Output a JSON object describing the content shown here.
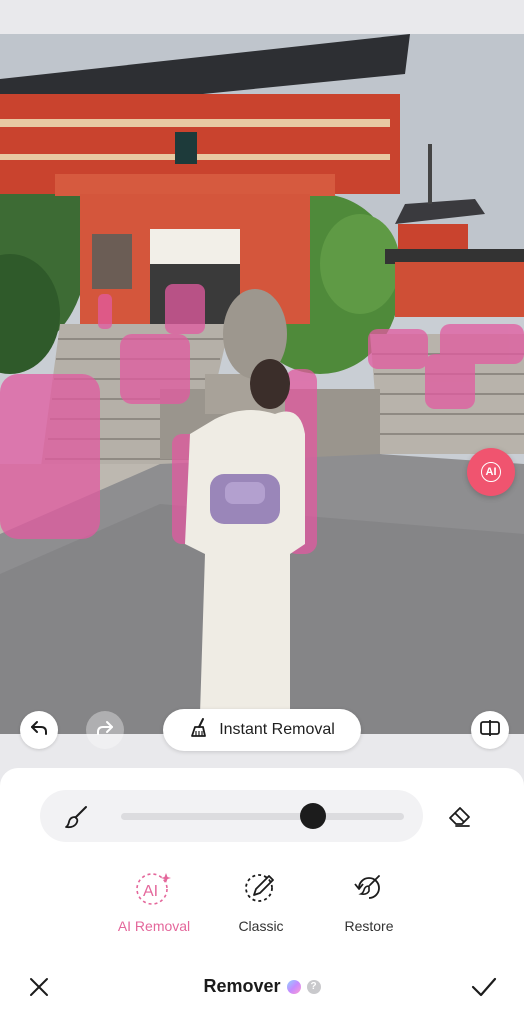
{
  "photo": {
    "description_icon": "image-canvas",
    "highlight_color": "#e25aa0"
  },
  "toolbar": {
    "undo_icon": "undo-icon",
    "redo_icon": "redo-icon",
    "compare_icon": "compare-icon",
    "ai_fab_label": "AI",
    "instant_removal_label": "Instant Removal"
  },
  "brush": {
    "brush_icon": "brush-icon",
    "eraser_icon": "eraser-icon",
    "size_level": 0.68
  },
  "tools": [
    {
      "label": "AI Removal",
      "icon": "ai-icon",
      "active": true
    },
    {
      "label": "Classic",
      "icon": "lasso-pen-icon",
      "active": false
    },
    {
      "label": "Restore",
      "icon": "restore-brush-icon",
      "active": false
    }
  ],
  "footer": {
    "title": "Remover",
    "help": "?"
  },
  "colors": {
    "accent": "#e4679b",
    "fab": "#f0546f",
    "dark": "#1c1c1c"
  }
}
